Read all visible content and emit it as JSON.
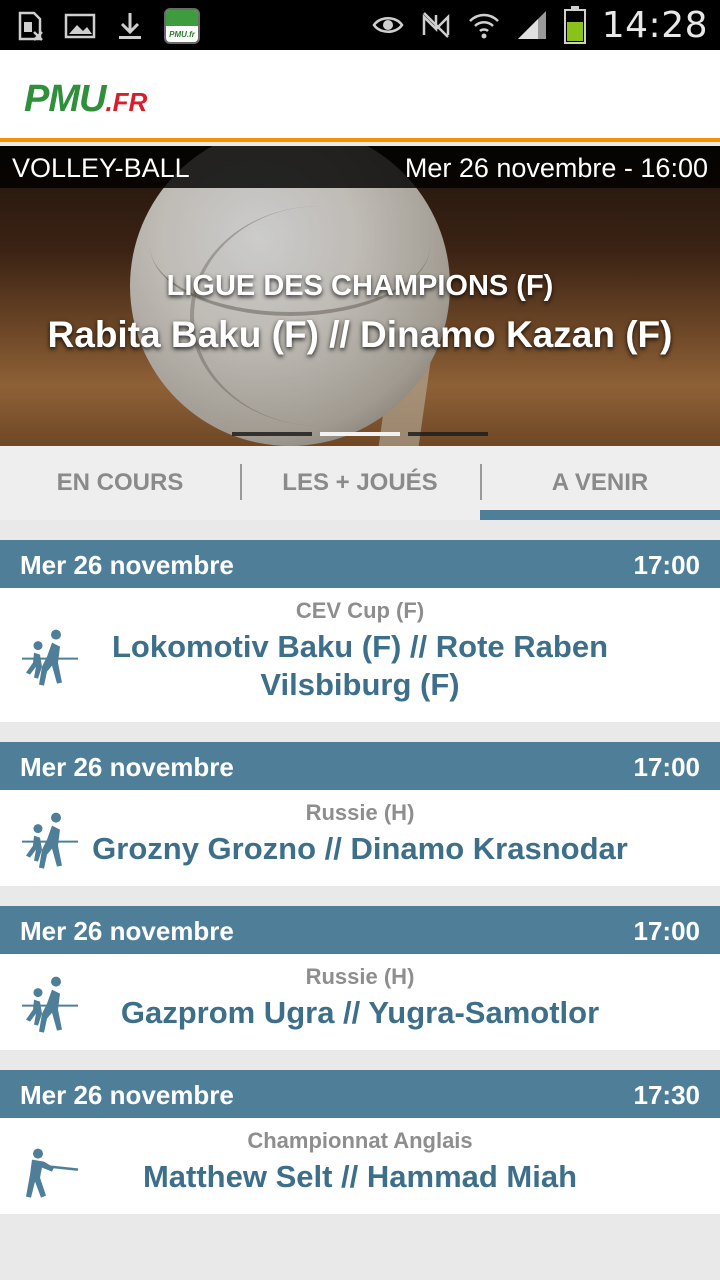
{
  "status_bar": {
    "time": "14:28",
    "left_icons": [
      "sim-card-icon",
      "image-icon",
      "download-icon",
      "pmu-app-icon"
    ],
    "right_icons": [
      "eye-icon",
      "nfc-muted-icon",
      "wifi-icon",
      "signal-icon",
      "battery-icon"
    ],
    "app_icon_text": "PMU.fr"
  },
  "header": {
    "logo_main": "PMU",
    "logo_suffix": ".FR"
  },
  "banner": {
    "sport": "VOLLEY-BALL",
    "date": "Mer 26 novembre - 16:00",
    "competition": "LIGUE DES CHAMPIONS (F)",
    "match": "Rabita Baku (F) // Dinamo Kazan (F)",
    "page_count": 3,
    "active_page": 2
  },
  "tabs": [
    {
      "label": "EN COURS",
      "active": false
    },
    {
      "label": "LES + JOUÉS",
      "active": false
    },
    {
      "label": "A VENIR",
      "active": true
    }
  ],
  "events": [
    {
      "date": "Mer 26 novembre",
      "time": "17:00",
      "competition": "CEV Cup (F)",
      "match": "Lokomotiv Baku (F) // Rote Raben Vilsbiburg (F)",
      "icon": "volleyball-icon"
    },
    {
      "date": "Mer 26 novembre",
      "time": "17:00",
      "competition": "Russie (H)",
      "match": "Grozny Grozno // Dinamo Krasnodar",
      "icon": "volleyball-icon"
    },
    {
      "date": "Mer 26 novembre",
      "time": "17:00",
      "competition": "Russie (H)",
      "match": "Gazprom Ugra // Yugra-Samotlor",
      "icon": "volleyball-icon"
    },
    {
      "date": "Mer 26 novembre",
      "time": "17:30",
      "competition": "Championnat Anglais",
      "match": "Matthew Selt // Hammad Miah",
      "icon": "snooker-icon"
    }
  ],
  "colors": {
    "accent_blue": "#4f7f98",
    "match_text": "#3e6f8a",
    "orange_rule": "#f39200",
    "logo_green": "#2f8f3a",
    "logo_red": "#d81e2c"
  }
}
